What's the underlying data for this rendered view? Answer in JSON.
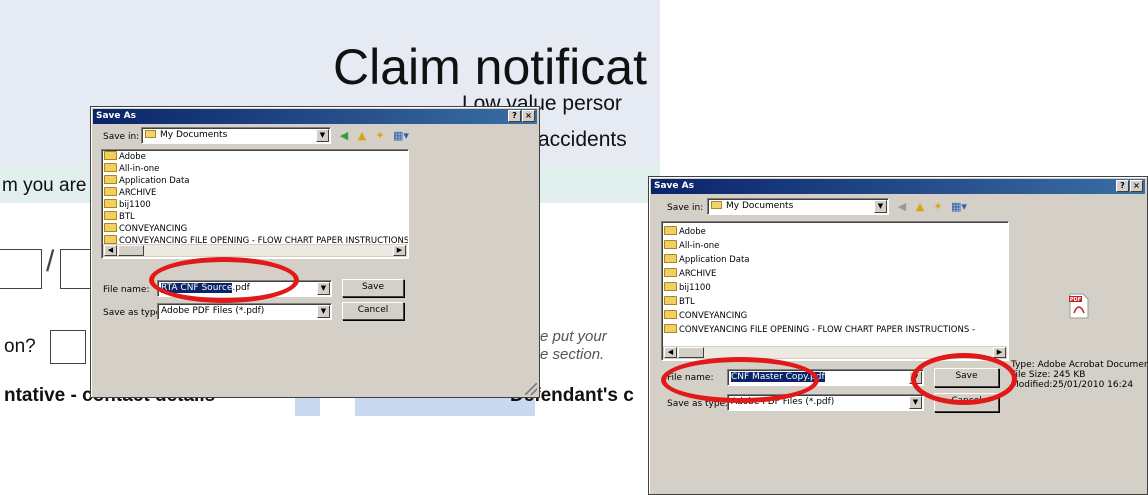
{
  "background": {
    "title": "Claim notificat",
    "subtitle1": "Low value persor",
    "subtitle2": "accidents",
    "claim_text": "m you are",
    "question": "on?",
    "note_line1": "e put your",
    "note_line2": "e section.",
    "rep_heading": "ntative - contact details",
    "defendant_heading": "Defendant's c",
    "colors": {
      "header_bg": "#e6eaf2",
      "band": "#e2efef",
      "strip": "#c9d9ef"
    }
  },
  "dialog1": {
    "title": "Save As",
    "help_btn": "?",
    "close_btn": "×",
    "save_in_label": "Save in:",
    "save_in_value": "My Documents",
    "files": [
      "Adobe",
      "All-in-one",
      "Application Data",
      "ARCHIVE",
      "bij1100",
      "BTL",
      "CONVEYANCING",
      "CONVEYANCING FILE OPENING - FLOW CHART PAPER INSTRUCTIONS -"
    ],
    "file_name_label": "File name:",
    "file_name_selected": "RTA CNF Source",
    "file_name_ext": ".pdf",
    "save_type_label": "Save as type:",
    "save_type_value": "Adobe PDF Files (*.pdf)",
    "save_button": "Save",
    "cancel_button": "Cancel"
  },
  "dialog2": {
    "title": "Save As",
    "help_btn": "?",
    "close_btn": "×",
    "save_in_label": "Save in:",
    "save_in_value": "My Documents",
    "files": [
      "Adobe",
      "All-in-one",
      "Application Data",
      "ARCHIVE",
      "bij1100",
      "BTL",
      "CONVEYANCING",
      "CONVEYANCING FILE OPENING - FLOW CHART PAPER INSTRUCTIONS -"
    ],
    "file_name_label": "File name:",
    "file_name_value": "CNF Master Copy.pdf",
    "save_type_label": "Save as type:",
    "save_type_value": "Adobe PDF Files (*.pdf)",
    "save_button": "Save",
    "cancel_button": "Cancel",
    "preview_icon_label": "PDF",
    "info_type": "Type: Adobe Acrobat Document",
    "info_size": "File Size: 245 KB",
    "info_modified": "Modified:25/01/2010 16:24"
  },
  "colors": {
    "highlight_ring": "#e11919",
    "title_bar": "#0a246a",
    "dialog_face": "#d4d0c8"
  }
}
